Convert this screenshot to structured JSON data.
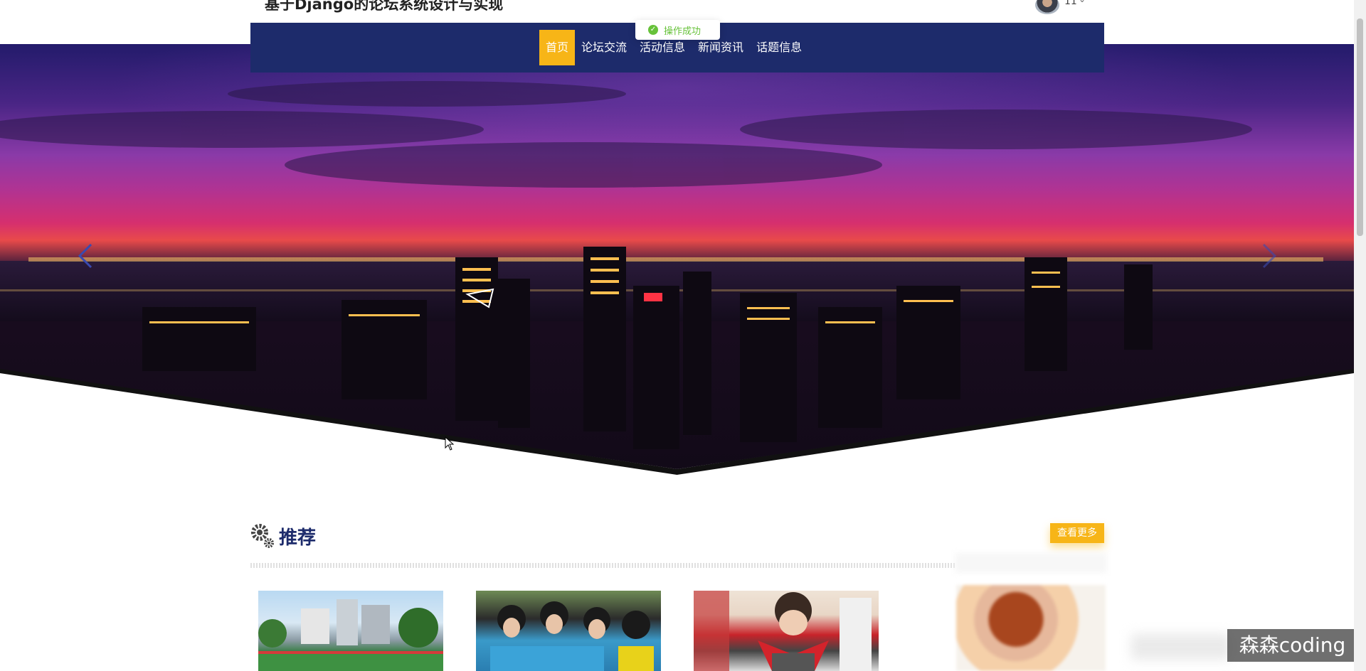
{
  "header": {
    "site_title": "基于Django的论坛系统设计与实现",
    "user_name": "11",
    "user_caret": "⌄"
  },
  "nav": {
    "items": [
      {
        "label": "首页",
        "active": true
      },
      {
        "label": "论坛交流",
        "active": false
      },
      {
        "label": "活动信息",
        "active": false
      },
      {
        "label": "新闻资讯",
        "active": false
      },
      {
        "label": "话题信息",
        "active": false
      }
    ]
  },
  "toast": {
    "message": "操作成功",
    "icon": "check-circle-icon"
  },
  "section": {
    "title": "推荐",
    "more_label": "查看更多"
  },
  "watermark": "森森coding",
  "colors": {
    "nav_bg": "#1d2b6b",
    "accent": "#f7b517",
    "success": "#67c23a"
  }
}
